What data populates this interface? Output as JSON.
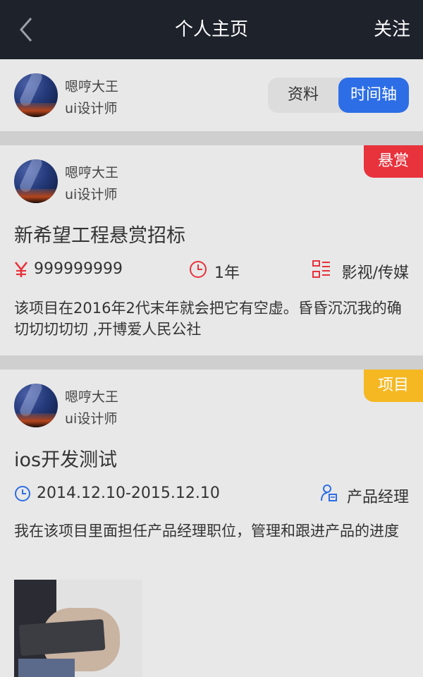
{
  "header": {
    "title": "个人主页",
    "follow_label": "关注",
    "back_icon": "chevron-left-icon"
  },
  "profile": {
    "name": "嗯哼大王",
    "role": "ui设计师",
    "tabs": [
      {
        "label": "资料",
        "active": false
      },
      {
        "label": "时间轴",
        "active": true
      }
    ],
    "accent": "#2d6ee6"
  },
  "cards": [
    {
      "tag": "悬赏",
      "tag_color": "#e8323c",
      "author": {
        "name": "嗯哼大王",
        "role": "ui设计师"
      },
      "title": "新希望工程悬赏招标",
      "amount": "999999999",
      "duration": "1年",
      "category": "影视/传媒",
      "description": "该项目在2016年2代末年就会把它有空虚。昏昏沉沉我的确切切切切切 ,开博爱人民公社"
    },
    {
      "tag": "项目",
      "tag_color": "#f5b823",
      "author": {
        "name": "嗯哼大王",
        "role": "ui设计师"
      },
      "title": "ios开发测试",
      "period": "2014.12.10-2015.12.10",
      "position": "产品经理",
      "description": "我在该项目里面担任产品经理职位，管理和跟进产品的进度"
    }
  ]
}
